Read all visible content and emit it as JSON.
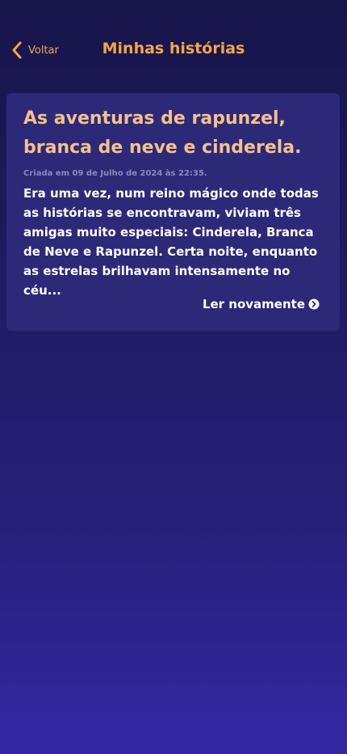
{
  "header": {
    "back_label": "Voltar",
    "back_icon": "chevron-left-icon",
    "title": "Minhas histórias"
  },
  "stories": [
    {
      "title": "As aventuras de rapunzel, branca  de neve e cinderela.",
      "created_at": "Criada em 09 de Julho de 2024 às 22:35.",
      "excerpt": "Era uma vez, num reino mágico onde todas as histórias se encontravam, viviam três amigas muito especiais: Cinderela, Branca de Neve e Rapunzel. Certa noite, enquanto as estrelas brilhavam intensamente no céu...",
      "action_label": "Ler novamente",
      "action_icon": "chevron-right-circle-icon"
    }
  ],
  "colors": {
    "accent": "#f4a64a",
    "card_title": "#f6c08e",
    "card_background": "#2c2a78",
    "date_text": "#8d8ab6",
    "background_top": "#17154a",
    "background_bottom": "#3428a3"
  }
}
